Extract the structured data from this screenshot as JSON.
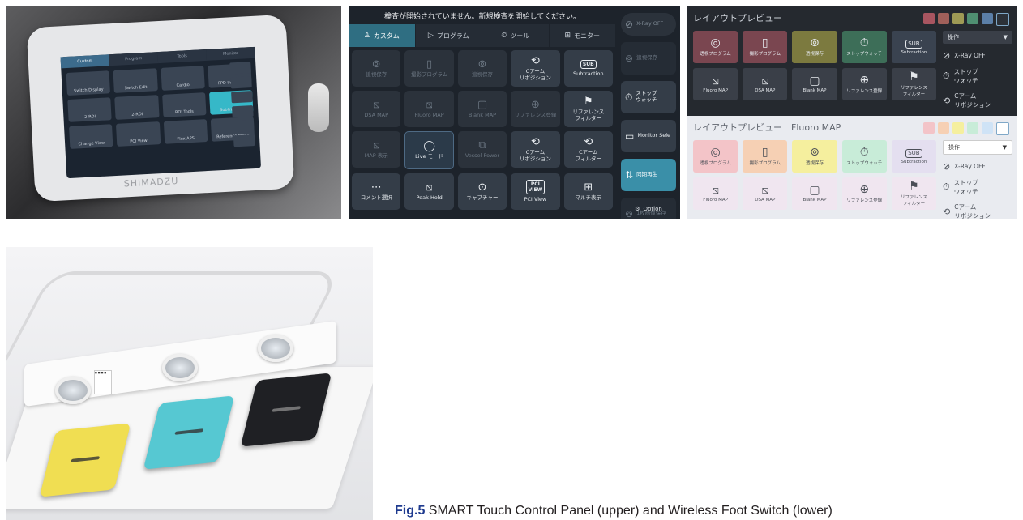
{
  "panel1": {
    "tabs": [
      "Custom",
      "Program",
      "Tools",
      "Monitor"
    ],
    "tiles": [
      "Switch Display",
      "Switch Edit",
      "Cardio",
      "FPD Images",
      "2-ROI",
      "2-ROI",
      "ROI Tools",
      "Subtraction",
      "Change View",
      "PCI View",
      "Flex APS",
      "Reference Mode"
    ],
    "brand": "SHIMADZU"
  },
  "panel2": {
    "notice": "検査が開始されていません。新規検査を開始してください。",
    "tabs": [
      {
        "label": "カスタム",
        "icon": "person-icon",
        "glyph": "♙"
      },
      {
        "label": "プログラム",
        "icon": "program-icon",
        "glyph": "▷"
      },
      {
        "label": "ツール",
        "icon": "timer-icon",
        "glyph": "⏱"
      },
      {
        "label": "モニター",
        "icon": "monitor-icon",
        "glyph": "⊞"
      }
    ],
    "buttons": [
      {
        "label": "追視保存",
        "glyph": "⊚",
        "state": "dim"
      },
      {
        "label": "撮影プログラム",
        "glyph": "▯",
        "state": "dim"
      },
      {
        "label": "追視保存",
        "glyph": "⊚",
        "state": "dim"
      },
      {
        "label": "Cアーム\nリポジション",
        "glyph": "⟲",
        "state": "on"
      },
      {
        "label": "Subtraction",
        "glyph": "SUB",
        "state": "on"
      },
      {
        "label": "DSA MAP",
        "glyph": "⧅",
        "state": "dim"
      },
      {
        "label": "Fluoro MAP",
        "glyph": "⧅",
        "state": "dim"
      },
      {
        "label": "Blank MAP",
        "glyph": "▢",
        "state": "dim"
      },
      {
        "label": "リファレンス登録",
        "glyph": "⊕",
        "state": "dim"
      },
      {
        "label": "リファレンス\nフィルター",
        "glyph": "⚑",
        "state": "on"
      },
      {
        "label": "MAP 表示",
        "glyph": "⧅",
        "state": "dim"
      },
      {
        "label": "Live モード",
        "glyph": "◯",
        "state": "sel"
      },
      {
        "label": "Vessel Power",
        "glyph": "⧉",
        "state": "dim"
      },
      {
        "label": "Cアーム\nリポジション",
        "glyph": "⟲",
        "state": "on"
      },
      {
        "label": "Cアーム\nフィルター",
        "glyph": "⟲",
        "state": "on"
      },
      {
        "label": "コメント選択",
        "glyph": "⋯",
        "state": "on"
      },
      {
        "label": "Peak Hold",
        "glyph": "⧅",
        "state": "on"
      },
      {
        "label": "キャプチャー",
        "glyph": "⊙",
        "state": "on"
      },
      {
        "label": "PCI View",
        "glyph": "PCI\nVIEW",
        "state": "on"
      },
      {
        "label": "マルチ表示",
        "glyph": "⊞",
        "state": "on"
      }
    ],
    "side": [
      {
        "label": "X-Ray OFF",
        "glyph": "⊘",
        "style": "xray"
      },
      {
        "label": "追視保存",
        "glyph": "⊚",
        "style": "dim"
      },
      {
        "label": "ストップ\nウォッチ",
        "glyph": "⏱",
        "style": "on"
      },
      {
        "label": "Monitor Sele",
        "glyph": "▭",
        "style": "on"
      },
      {
        "label": "同期再生",
        "glyph": "⇅",
        "style": "teal"
      },
      {
        "label": "1枚画像保存",
        "glyph": "⊚",
        "style": "dim"
      }
    ],
    "option": "Option"
  },
  "panel3": {
    "title_dark": "レイアウトプレビュー",
    "title_light": "レイアウトプレビュー　Fluoro MAP",
    "dropdown": "操作",
    "swatches_dark": [
      "#a85560",
      "#a0605a",
      "#9e9a55",
      "#4f8f72",
      "#5b7fa8",
      "#2c3138"
    ],
    "swatches_light": [
      "#f3c4c8",
      "#f6d0b4",
      "#f5ef9e",
      "#c8ecd8",
      "#cfe3f6",
      "#ffffff"
    ],
    "tiles": [
      {
        "label": "透視プログラム",
        "glyph": "◎",
        "dark": "#7a4650",
        "light": "#f3c4c8"
      },
      {
        "label": "撮影プログラム",
        "glyph": "▯",
        "dark": "#7a4650",
        "light": "#f6d0b4"
      },
      {
        "label": "透視保存",
        "glyph": "⊚",
        "dark": "#7c7a3f",
        "light": "#f5ef9e"
      },
      {
        "label": "ストップウォッチ",
        "glyph": "⏱",
        "dark": "#3d6e58",
        "light": "#c8ecd8"
      },
      {
        "label": "Subtraction",
        "glyph": "SUB",
        "dark": "#3a4350",
        "light": "#e4dff0"
      },
      {
        "label": "Fluoro MAP",
        "glyph": "⧅",
        "dark": "#3a3f48",
        "light": "#f0e6f0"
      },
      {
        "label": "DSA MAP",
        "glyph": "⧅",
        "dark": "#3a3f48",
        "light": "#f0e6f0"
      },
      {
        "label": "Blank MAP",
        "glyph": "▢",
        "dark": "#3a3f48",
        "light": "#f0e6f0"
      },
      {
        "label": "リファレンス登録",
        "glyph": "⊕",
        "dark": "#3a3f48",
        "light": "#f0e6f0"
      },
      {
        "label": "リファレンス\nフィルター",
        "glyph": "⚑",
        "dark": "#3a3f48",
        "light": "#f0e6f0"
      }
    ],
    "side": [
      {
        "label": "X-Ray OFF",
        "glyph": "⊘"
      },
      {
        "label": "ストップ\nウォッチ",
        "glyph": "⏱"
      },
      {
        "label": "Cアーム\nリポジション",
        "glyph": "⟲"
      }
    ]
  },
  "panel4": {
    "pedal_colors": [
      "#f0de52",
      "#56c8d2",
      "#1f2024"
    ],
    "label_text": "■ ■ ■ ■"
  },
  "caption": {
    "fig": "Fig.5",
    "text": "  SMART Touch Control Panel (upper) and Wireless Foot Switch (lower)"
  }
}
